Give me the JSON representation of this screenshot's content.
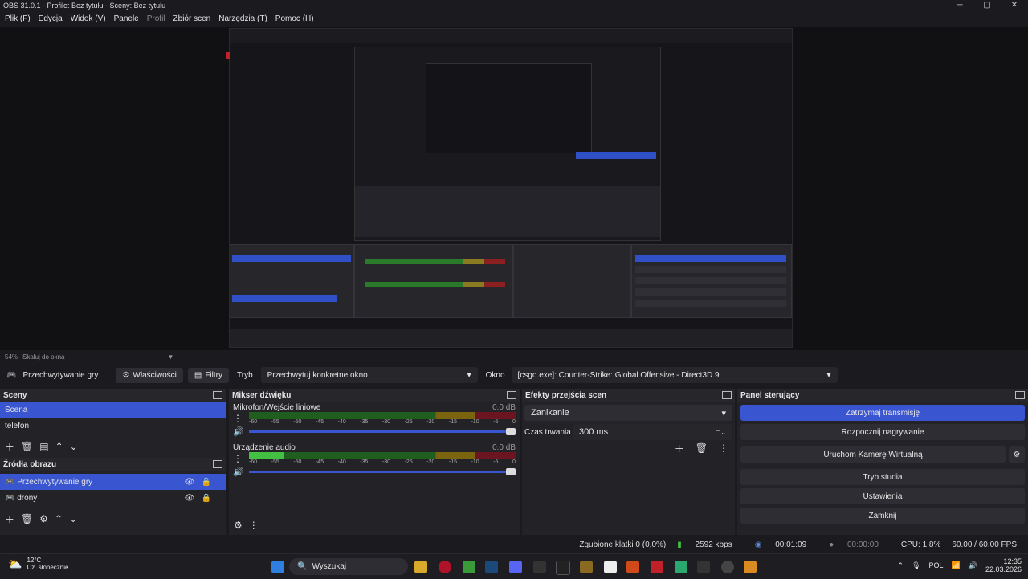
{
  "window": {
    "title": "OBS 31.0.1 - Profile: Bez tytułu - Sceny: Bez tytułu",
    "minimize": "─",
    "maximize": "▢",
    "close": "✕"
  },
  "menu": [
    "Plik (F)",
    "Edycja",
    "Widok (V)",
    "Panele",
    "Profil",
    "Zbiór scen",
    "Narzędzia (T)",
    "Pomoc (H)"
  ],
  "preview": {
    "zoom": "54%",
    "scale_mode": "Skaluj do okna"
  },
  "source_bar": {
    "source_name": "Przechwytywanie gry",
    "properties": "Właściwości",
    "filters": "Filtry",
    "mode_label": "Tryb",
    "mode_value": "Przechwytuj konkretne okno",
    "window_label": "Okno",
    "window_value": "[csgo.exe]: Counter-Strike: Global Offensive - Direct3D 9"
  },
  "scenes": {
    "title": "Sceny",
    "items": [
      "Scena",
      "telefon"
    ]
  },
  "sources": {
    "title": "Źródła obrazu",
    "items": [
      "Przechwytywanie gry",
      "drony"
    ]
  },
  "mixer": {
    "title": "Mikser dźwięku",
    "scale": [
      "-60",
      "-55",
      "-50",
      "-45",
      "-40",
      "-35",
      "-30",
      "-25",
      "-20",
      "-15",
      "-10",
      "-5",
      "0"
    ],
    "channels": [
      {
        "name": "Mikrofon/Wejście liniowe",
        "db": "0.0 dB",
        "level": 0.0
      },
      {
        "name": "Urządzenie audio",
        "db": "0.0 dB",
        "level": 0.13
      }
    ]
  },
  "transitions": {
    "title": "Efekty przejścia scen",
    "selected": "Zanikanie",
    "duration_label": "Czas trwania",
    "duration_value": "300 ms"
  },
  "controls": {
    "title": "Panel sterujący",
    "buttons": [
      "Zatrzymaj transmisję",
      "Rozpocznij nagrywanie",
      "Uruchom Kamerę Wirtualną",
      "Tryb studia",
      "Ustawienia",
      "Zamknij"
    ]
  },
  "status": {
    "dropped": "Zgubione klatki 0 (0,0%)",
    "bitrate": "2592 kbps",
    "stream_time": "00:01:09",
    "rec_time": "00:00:00",
    "cpu": "CPU: 1.8%",
    "fps": "60.00 / 60.00 FPS"
  },
  "taskbar": {
    "weather_temp": "12°C",
    "weather_desc": "Cz. słonecznie",
    "search": "Wyszukaj",
    "lang": "POL",
    "time": "12:35",
    "date": "22.03.2026"
  },
  "colors": {
    "accent": "#3a55d0",
    "bg": "#1b1b1f",
    "panel": "#222227"
  }
}
